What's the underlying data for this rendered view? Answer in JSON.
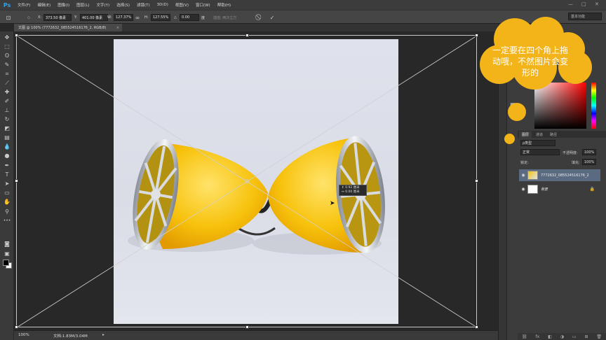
{
  "app": {
    "logo": "Ps"
  },
  "menu": [
    "文件(F)",
    "编辑(E)",
    "图像(I)",
    "图层(L)",
    "文字(Y)",
    "选择(S)",
    "滤镜(T)",
    "3D(D)",
    "视图(V)",
    "窗口(W)",
    "帮助(H)"
  ],
  "window_controls": {
    "minimize": "—",
    "maximize": "□",
    "close": "✕"
  },
  "options": {
    "x_label": "X:",
    "x_value": "373.50 像素",
    "y_label": "Y:",
    "y_value": "401.00 像素",
    "w_label": "W:",
    "w_value": "127.37%",
    "link_icon": "link-icon",
    "h_label": "H:",
    "h_value": "127.55%",
    "angle_label": "△",
    "angle_value": "0.00",
    "degree": "度",
    "interp": "插值: 两次立方",
    "cancel": "⃠",
    "commit": "✓"
  },
  "workspace": "基本功能",
  "document": {
    "tab": "文图 @ 100% (7772632_085524516176_2, RGB/8)",
    "close": "×"
  },
  "tooltip": {
    "line1": "↕  0.92 厘米",
    "line2": "↔  0.00 厘米"
  },
  "status": {
    "zoom": "100%",
    "doc": "文档:1.83M/3.04M",
    "arrow": "▸"
  },
  "annotation": {
    "text": "一定要在四个角上拖动哦，不然图片会变形的"
  },
  "layers_panel": {
    "tabs": [
      "图层",
      "通道",
      "路径"
    ],
    "kind": "ρ类型",
    "blend": "正常",
    "opacity_label": "不透明度:",
    "opacity_value": "100%",
    "lock_label": "锁定:",
    "fill_label": "填充:",
    "fill_value": "100%",
    "layers": [
      {
        "name": "7772632_085524516176_2",
        "selected": true
      },
      {
        "name": "背景",
        "selected": false,
        "locked": true
      }
    ],
    "footer": [
      "⛓",
      "fx",
      "◧",
      "◑",
      "▭",
      "⊞",
      "🗑"
    ]
  },
  "colors": {
    "accent": "#f3b41a",
    "panel": "#3c3c3c",
    "selection": "#5a6a80"
  }
}
